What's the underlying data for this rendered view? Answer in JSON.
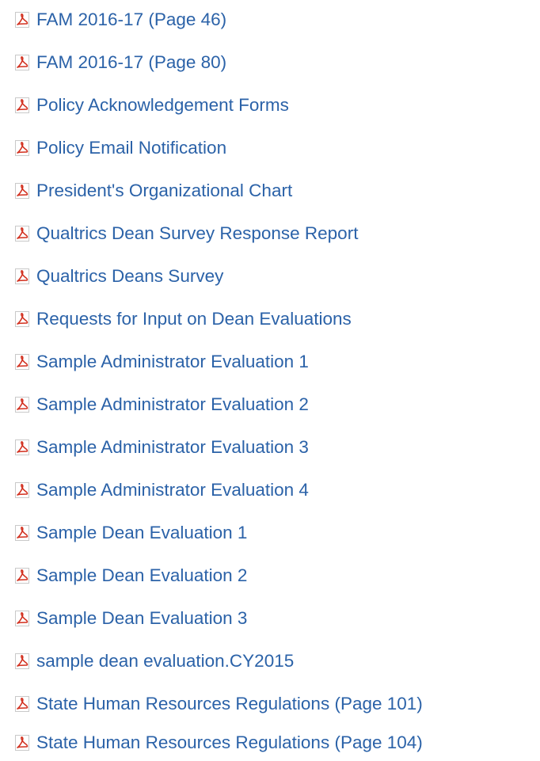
{
  "documents": [
    {
      "label": "FAM 2016-17 (Page 46)",
      "icon": "pdf-icon"
    },
    {
      "label": "FAM 2016-17 (Page 80)",
      "icon": "pdf-icon"
    },
    {
      "label": "Policy Acknowledgement Forms",
      "icon": "pdf-icon"
    },
    {
      "label": "Policy Email Notification",
      "icon": "pdf-icon"
    },
    {
      "label": "President's Organizational Chart",
      "icon": "pdf-icon"
    },
    {
      "label": "Qualtrics Dean Survey Response Report",
      "icon": "pdf-icon"
    },
    {
      "label": "Qualtrics Deans Survey",
      "icon": "pdf-icon"
    },
    {
      "label": "Requests for Input on Dean Evaluations",
      "icon": "pdf-icon"
    },
    {
      "label": "Sample Administrator Evaluation 1",
      "icon": "pdf-icon"
    },
    {
      "label": "Sample Administrator Evaluation 2",
      "icon": "pdf-icon"
    },
    {
      "label": "Sample Administrator Evaluation 3",
      "icon": "pdf-icon"
    },
    {
      "label": "Sample Administrator Evaluation 4",
      "icon": "pdf-icon"
    },
    {
      "label": "Sample Dean Evaluation 1",
      "icon": "pdf-icon"
    },
    {
      "label": "Sample Dean Evaluation 2",
      "icon": "pdf-icon"
    },
    {
      "label": "Sample Dean Evaluation 3",
      "icon": "pdf-icon"
    },
    {
      "label": "sample dean evaluation.CY2015",
      "icon": "pdf-icon"
    },
    {
      "label": "State Human Resources Regulations (Page 101)",
      "icon": "pdf-icon"
    },
    {
      "label": "State Human Resources Regulations (Page 104)",
      "icon": "pdf-icon"
    }
  ],
  "colors": {
    "link": "#2b62a8",
    "pdf_icon": "#d2301f"
  }
}
